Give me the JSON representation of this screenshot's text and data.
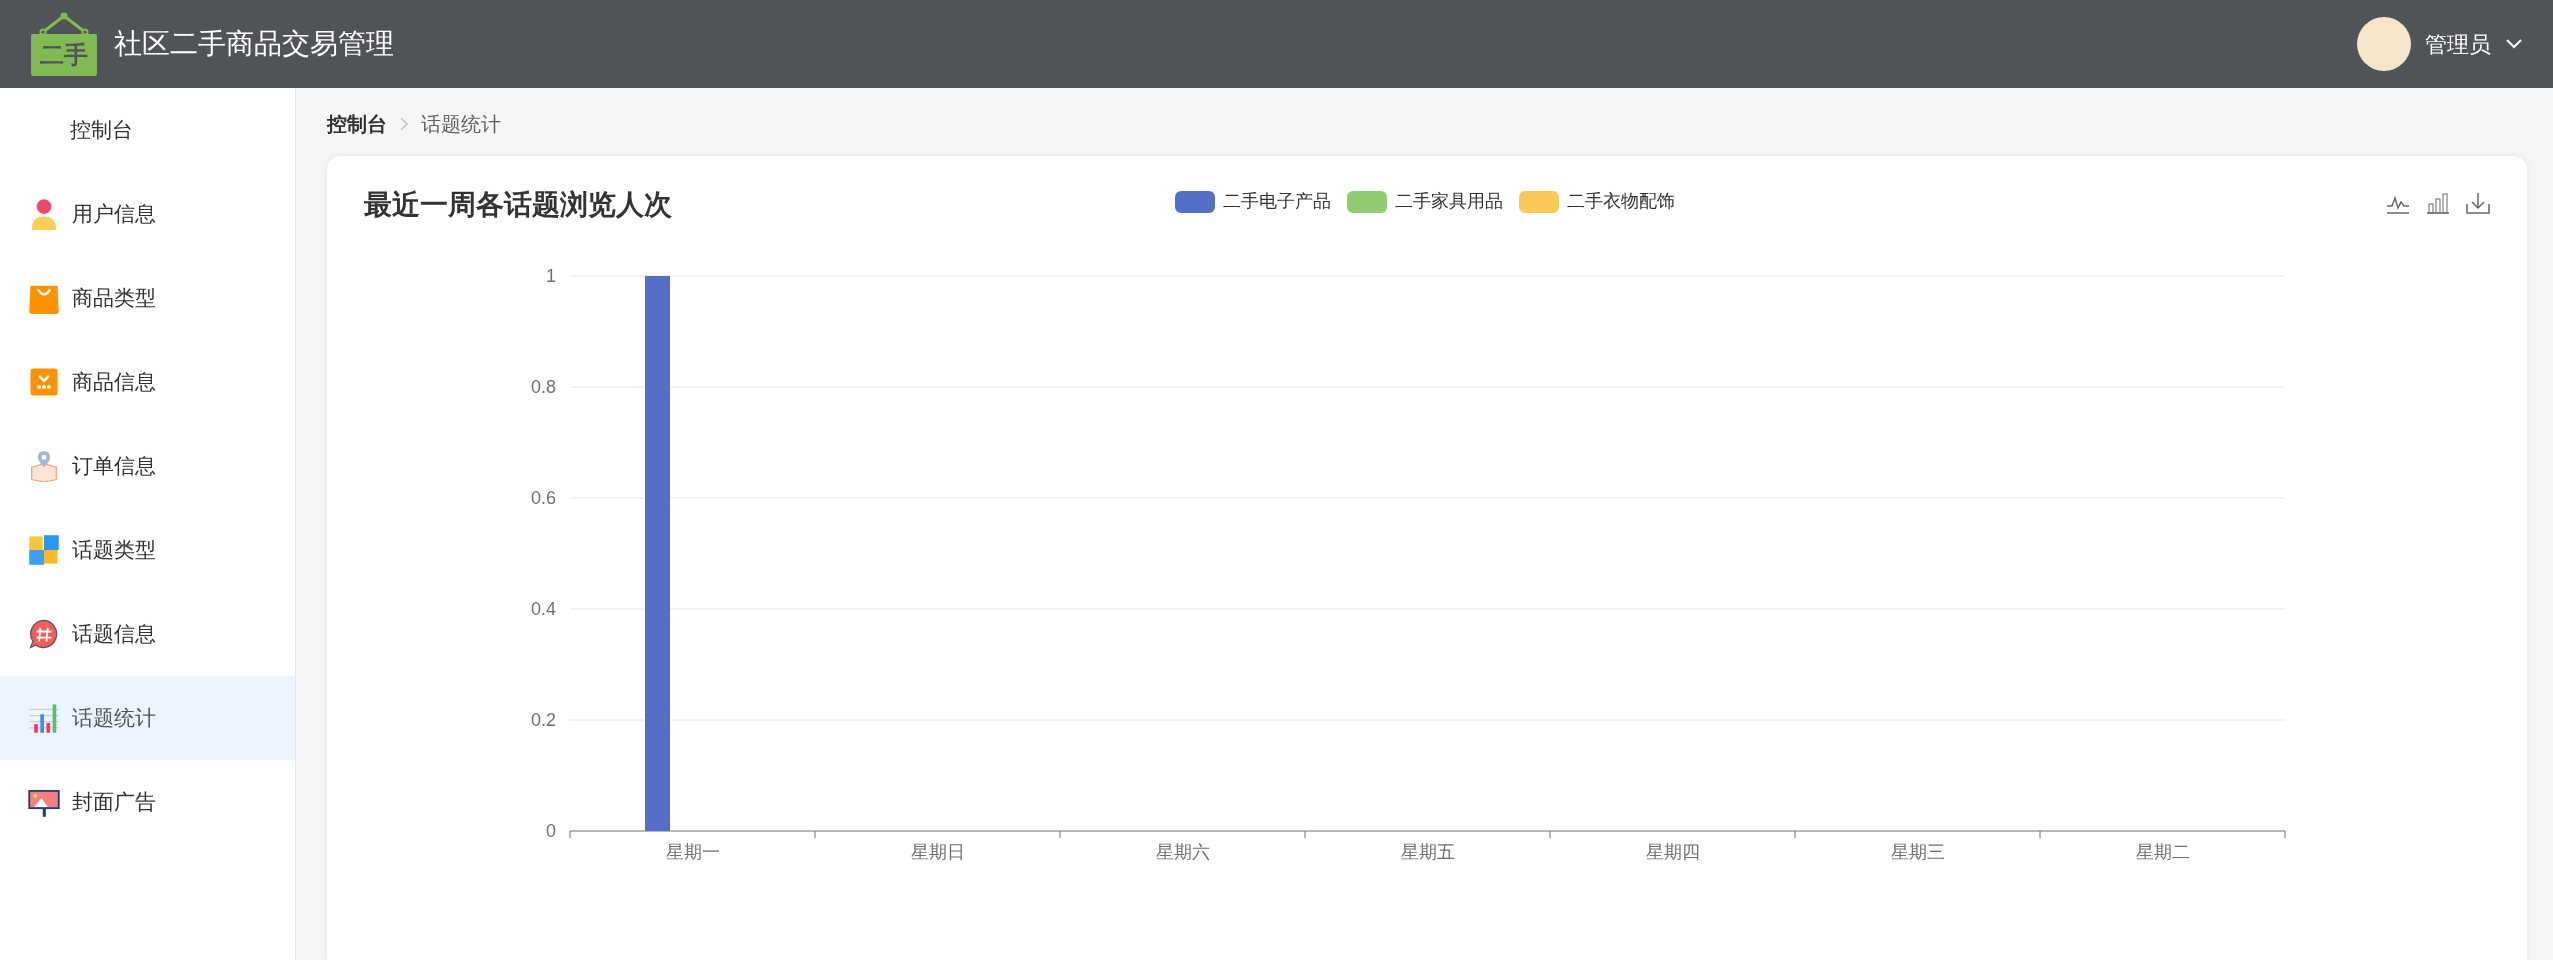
{
  "header": {
    "logo_text": "二手",
    "title": "社区二手商品交易管理",
    "user": "管理员"
  },
  "sidebar": {
    "items": [
      {
        "label": "控制台",
        "selected": false
      },
      {
        "label": "用户信息",
        "selected": false
      },
      {
        "label": "商品类型",
        "selected": false
      },
      {
        "label": "商品信息",
        "selected": false
      },
      {
        "label": "订单信息",
        "selected": false
      },
      {
        "label": "话题类型",
        "selected": false
      },
      {
        "label": "话题信息",
        "selected": false
      },
      {
        "label": "话题统计",
        "selected": true
      },
      {
        "label": "封面广告",
        "selected": false
      }
    ]
  },
  "breadcrumb": [
    "控制台",
    "话题统计"
  ],
  "card": {
    "title": "最近一周各话题浏览人次",
    "chart_data": {
      "type": "bar",
      "categories": [
        "星期一",
        "星期日",
        "星期六",
        "星期五",
        "星期四",
        "星期三",
        "星期二"
      ],
      "series": [
        {
          "name": "二手电子产品",
          "color": "#5470c6",
          "values": [
            1,
            0,
            0,
            0,
            0,
            0,
            0
          ]
        },
        {
          "name": "二手家具用品",
          "color": "#91cc75",
          "values": [
            0,
            0,
            0,
            0,
            0,
            0,
            0
          ]
        },
        {
          "name": "二手衣物配饰",
          "color": "#fac858",
          "values": [
            0,
            0,
            0,
            0,
            0,
            0,
            0
          ]
        }
      ],
      "ylim": [
        0,
        1
      ],
      "grid": true,
      "yticks": [
        0,
        0.2,
        0.4,
        0.6,
        0.8,
        1
      ]
    }
  }
}
